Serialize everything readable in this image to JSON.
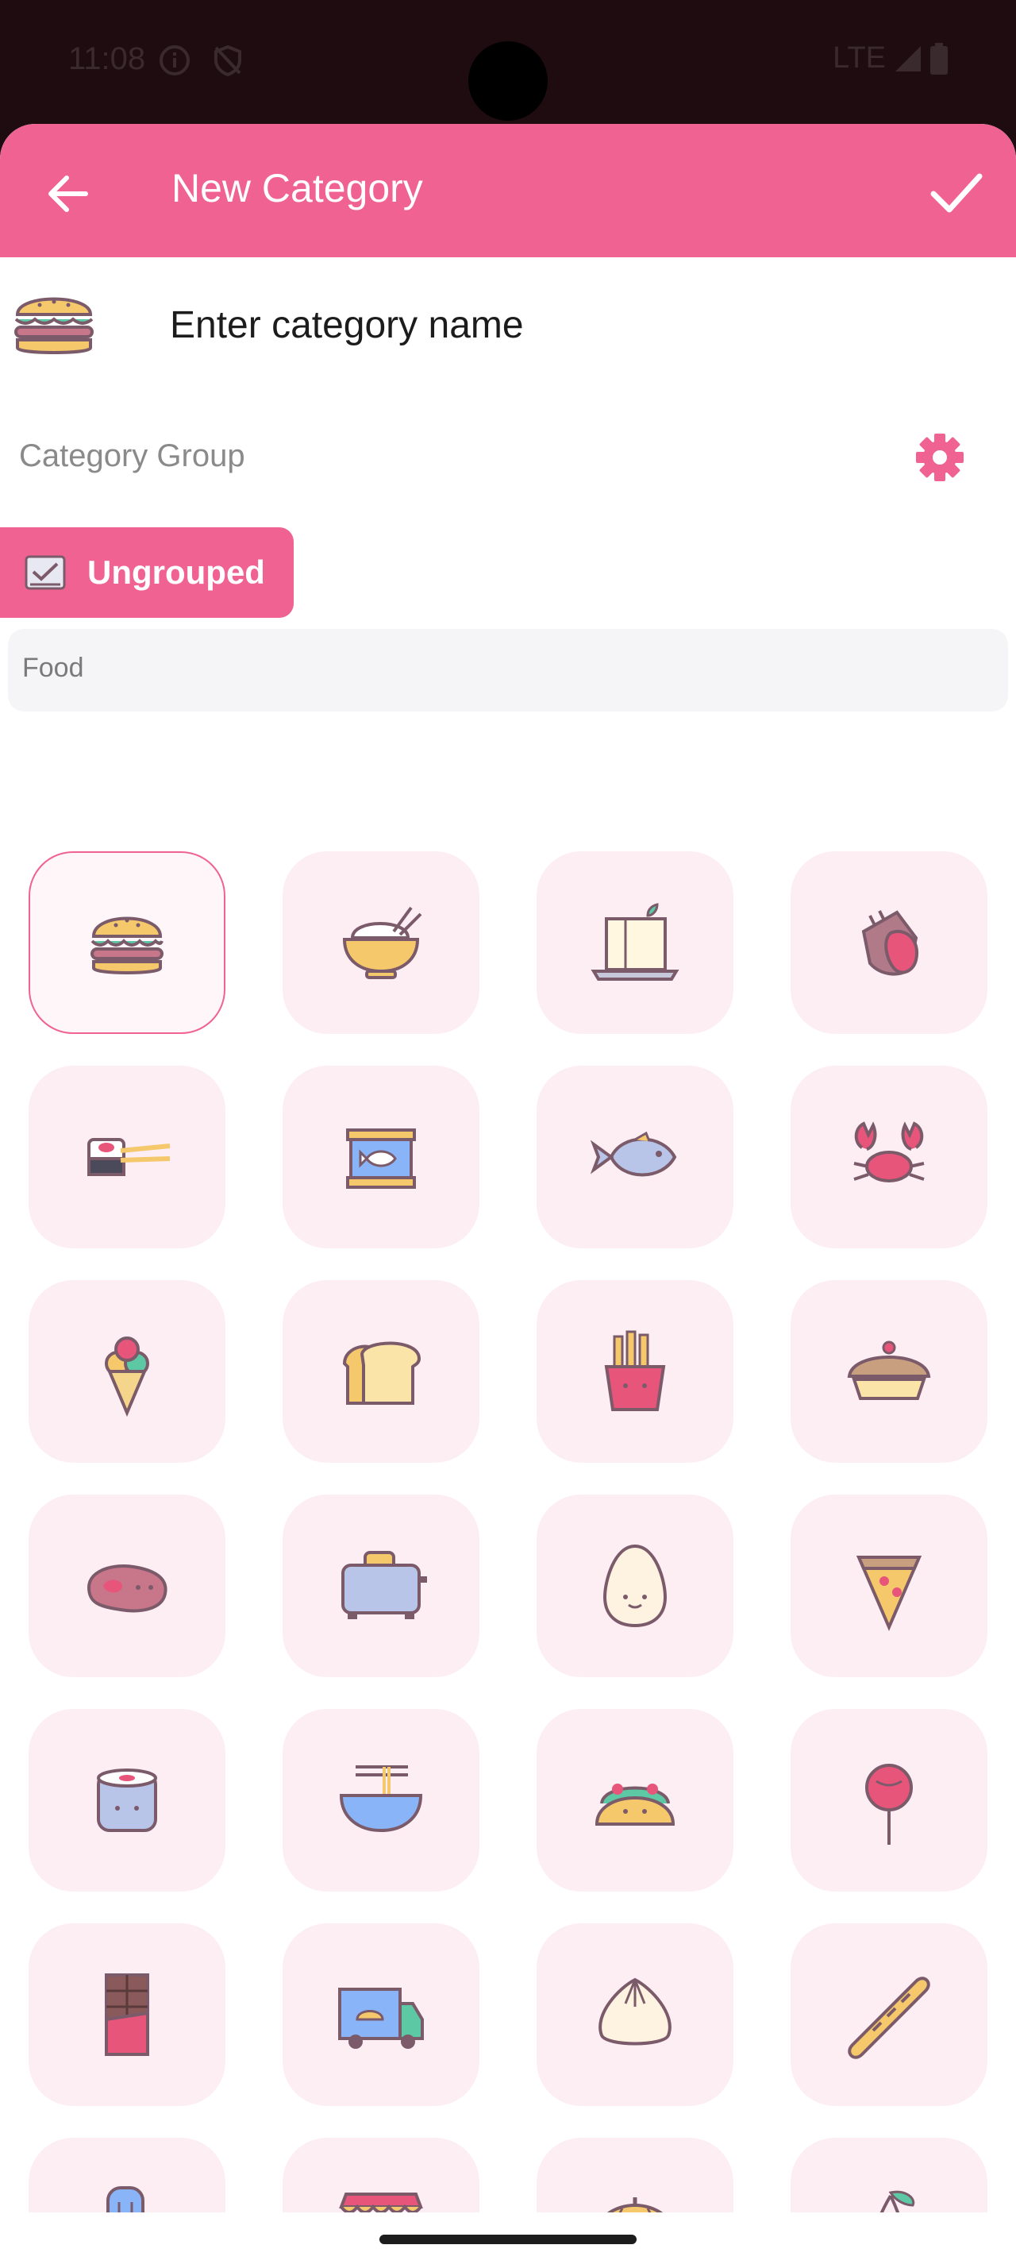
{
  "status": {
    "time": "11:08",
    "network": "LTE"
  },
  "appbar": {
    "title": "New Category"
  },
  "name_input": {
    "placeholder": "Enter category name"
  },
  "group": {
    "label": "Category Group",
    "chip_label": "Ungrouped"
  },
  "section": {
    "title": "Food"
  },
  "colors": {
    "accent": "#f06292",
    "tile_bg": "#fdeef3"
  },
  "icons": [
    {
      "name": "burger-icon",
      "selected": true
    },
    {
      "name": "rice-bowl-icon"
    },
    {
      "name": "tofu-icon"
    },
    {
      "name": "meat-ribs-icon"
    },
    {
      "name": "sushi-chopsticks-icon"
    },
    {
      "name": "canned-fish-icon"
    },
    {
      "name": "fish-icon"
    },
    {
      "name": "crab-icon"
    },
    {
      "name": "ice-cream-icon"
    },
    {
      "name": "bread-icon"
    },
    {
      "name": "fries-icon"
    },
    {
      "name": "pie-icon"
    },
    {
      "name": "steak-icon"
    },
    {
      "name": "toaster-icon"
    },
    {
      "name": "egg-icon"
    },
    {
      "name": "pizza-slice-icon"
    },
    {
      "name": "sushi-roll-icon"
    },
    {
      "name": "noodles-icon"
    },
    {
      "name": "taco-icon"
    },
    {
      "name": "lollipop-icon"
    },
    {
      "name": "chocolate-bar-icon"
    },
    {
      "name": "food-truck-icon"
    },
    {
      "name": "dumpling-icon"
    },
    {
      "name": "baguette-icon"
    },
    {
      "name": "popsicle-icon"
    },
    {
      "name": "food-stall-icon"
    },
    {
      "name": "pumpkin-icon"
    },
    {
      "name": "cherries-icon"
    }
  ]
}
